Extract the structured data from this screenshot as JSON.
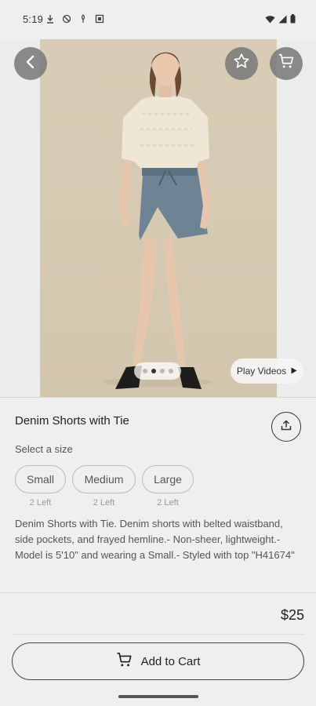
{
  "status_bar": {
    "time": "5:19",
    "left_icons": [
      "download-icon",
      "vpn-shield-icon",
      "microphone-icon",
      "app-notification-icon"
    ],
    "right_icons": [
      "wifi-icon",
      "signal-icon",
      "battery-icon"
    ]
  },
  "hero": {
    "back_icon": "back-arrow-icon",
    "favorite_icon": "star-outline-icon",
    "cart_icon": "shopping-cart-icon",
    "carousel": {
      "total": 4,
      "active_index": 1
    },
    "play_videos_label": "Play Videos"
  },
  "product": {
    "title": "Denim Shorts with Tie",
    "share_icon": "share-icon",
    "size_label": "Select a size",
    "sizes": [
      {
        "label": "Small",
        "stock": "2 Left"
      },
      {
        "label": "Medium",
        "stock": "2 Left"
      },
      {
        "label": "Large",
        "stock": "2 Left"
      }
    ],
    "description": "Denim Shorts with Tie. Denim shorts with belted waistband, side pockets, and frayed hemline.- Non-sheer, lightweight.- Model is 5'10\" and wearing a Small.- Styled with top \"H41674\"",
    "price": "$25"
  },
  "actions": {
    "add_to_cart_label": "Add to Cart"
  }
}
